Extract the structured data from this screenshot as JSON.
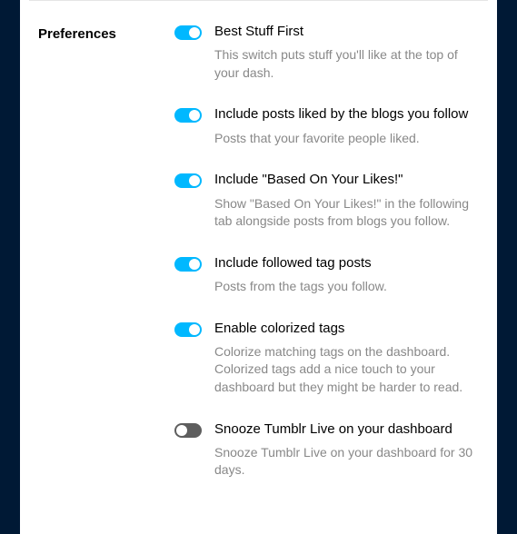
{
  "section_title": "Preferences",
  "prefs": [
    {
      "title": "Best Stuff First",
      "desc": "This switch puts stuff you'll like at the top of your dash.",
      "on": true
    },
    {
      "title": "Include posts liked by the blogs you follow",
      "desc": "Posts that your favorite people liked.",
      "on": true
    },
    {
      "title": "Include \"Based On Your Likes!\"",
      "desc": "Show \"Based On Your Likes!\" in the following tab alongside posts from blogs you follow.",
      "on": true
    },
    {
      "title": "Include followed tag posts",
      "desc": "Posts from the tags you follow.",
      "on": true
    },
    {
      "title": "Enable colorized tags",
      "desc": "Colorize matching tags on the dashboard. Colorized tags add a nice touch to your dashboard but they might be harder to read.",
      "on": true
    },
    {
      "title": "Snooze Tumblr Live on your dashboard",
      "desc": "Snooze Tumblr Live on your dashboard for 30 days.",
      "on": false
    }
  ]
}
